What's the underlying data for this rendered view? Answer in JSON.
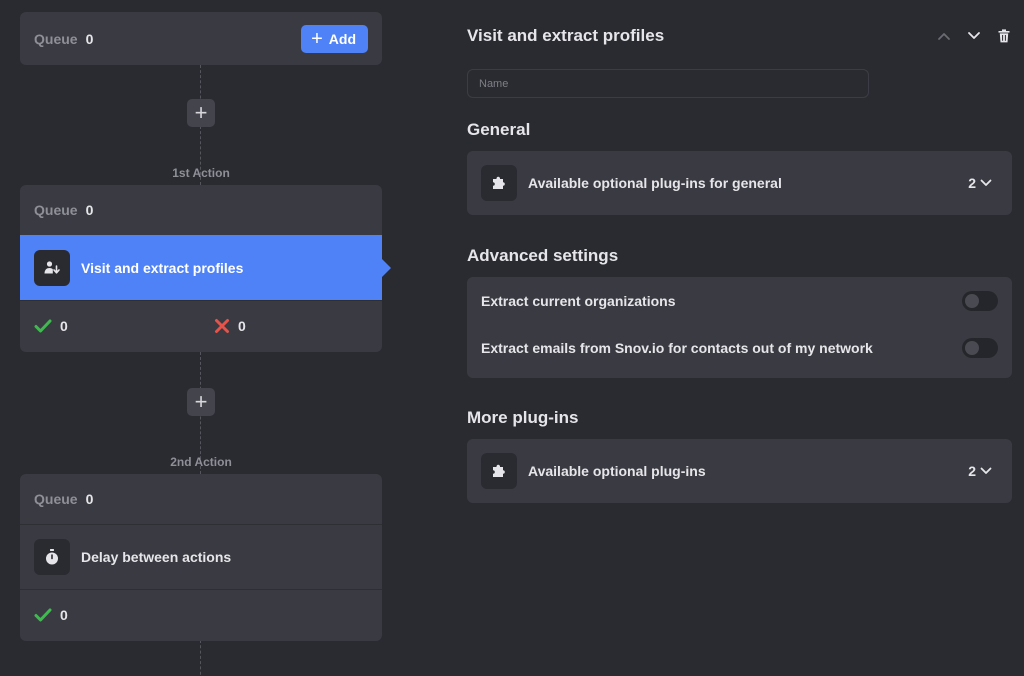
{
  "workflow": {
    "start": {
      "queue_label": "Queue",
      "queue_count": "0",
      "add_label": "Add"
    },
    "steps": [
      {
        "step_label": "1st Action",
        "queue_label": "Queue",
        "queue_count": "0",
        "action_name": "Visit and extract profiles",
        "success_count": "0",
        "fail_count": "0"
      },
      {
        "step_label": "2nd Action",
        "queue_label": "Queue",
        "queue_count": "0",
        "action_name": "Delay between actions",
        "success_count": "0"
      }
    ]
  },
  "panel": {
    "title": "Visit and extract profiles",
    "name_placeholder": "Name",
    "general": {
      "title": "General",
      "plugin_label": "Available optional plug-ins for general",
      "plugin_count": "2"
    },
    "advanced": {
      "title": "Advanced settings",
      "settings": [
        {
          "label": "Extract current organizations"
        },
        {
          "label": "Extract emails from Snov.io for contacts out of my network"
        }
      ]
    },
    "more": {
      "title": "More plug-ins",
      "plugin_label": "Available optional plug-ins",
      "plugin_count": "2"
    }
  },
  "colors": {
    "background": "#2a2b31",
    "card": "#3a3b42",
    "accent": "#4f82f7",
    "success": "#3fb950",
    "fail": "#e5534b"
  }
}
